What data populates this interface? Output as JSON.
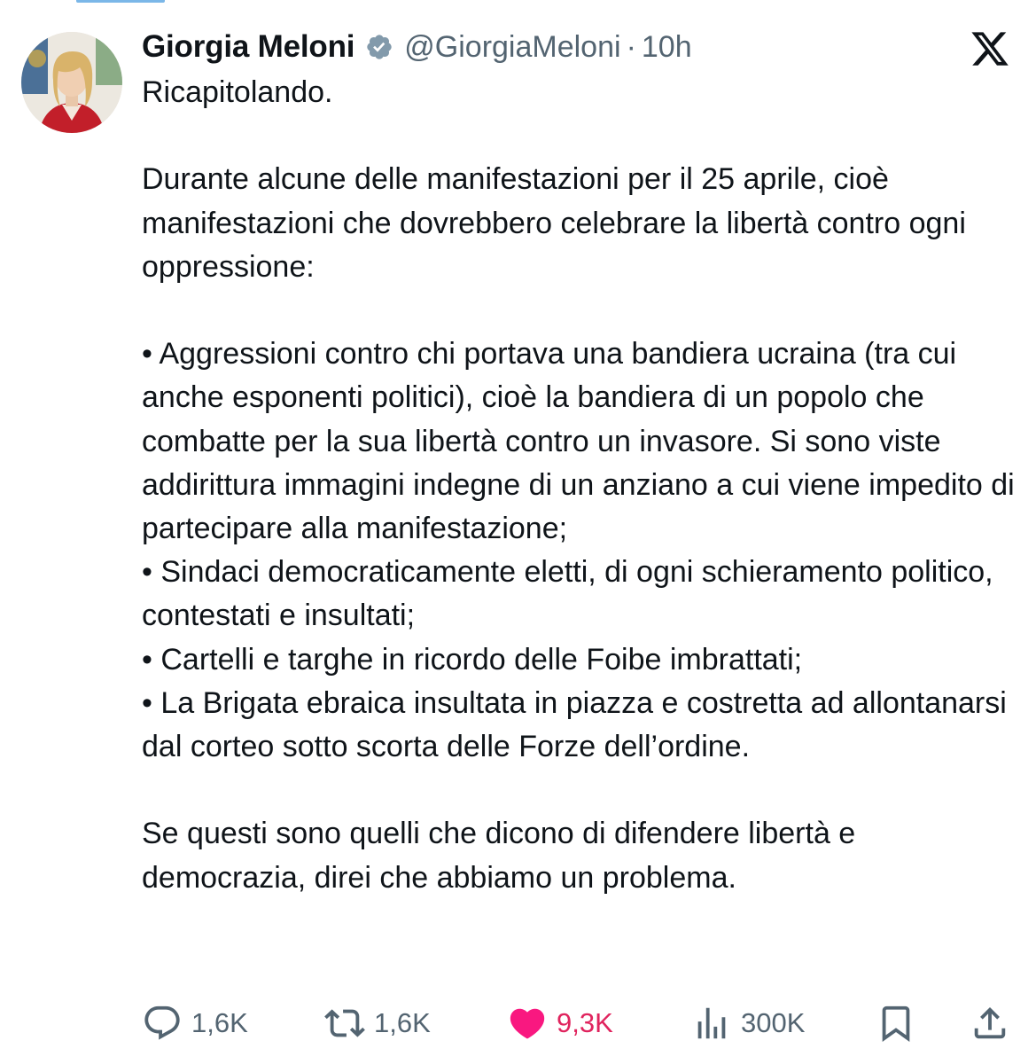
{
  "tweet": {
    "author_name": "Giorgia Meloni",
    "handle": "@GiorgiaMeloni",
    "separator": "·",
    "time": "10h",
    "body": "Ricapitolando.\n\nDurante alcune delle manifestazioni per il 25 aprile, cioè manifestazioni che dovrebbero celebrare la libertà contro ogni oppressione:\n\n• Aggressioni contro chi portava una bandiera ucraina (tra cui anche esponenti politici), cioè la bandiera di un popolo che combatte per la sua libertà contro un invasore. Si sono viste addirittura immagini indegne di un anziano a cui viene impedito di partecipare alla manifestazione;\n• Sindaci democraticamente eletti, di ogni schieramento politico, contestati e insultati;\n• Cartelli e targhe in ricordo delle Foibe imbrattati;\n• La Brigata ebraica insultata in piazza e costretta ad allontanarsi dal corteo sotto scorta delle Forze dell’ordine.\n\nSe questi sono quelli che dicono di difendere libertà e democrazia, direi che abbiamo un problema."
  },
  "actions": {
    "replies": "1,6K",
    "reposts": "1,6K",
    "likes": "9,3K",
    "views": "300K"
  },
  "icons": {
    "verified": "verified-badge-icon",
    "platform": "x-logo-icon",
    "reply": "reply-icon",
    "repost": "repost-icon",
    "like": "heart-icon",
    "views": "views-icon",
    "bookmark": "bookmark-icon",
    "share": "share-icon"
  },
  "colors": {
    "text": "#0f1419",
    "secondary": "#536471",
    "like": "#f91880",
    "verified": "#829aab"
  }
}
